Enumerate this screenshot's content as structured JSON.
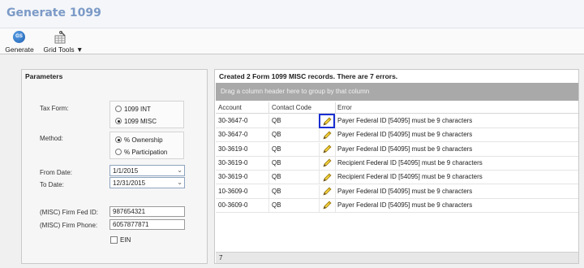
{
  "window": {
    "title": "Generate 1099"
  },
  "toolbar": {
    "generate_label": "Generate",
    "generate_icon_text": "GS",
    "grid_tools_label": "Grid Tools ▼"
  },
  "parameters": {
    "heading": "Parameters",
    "tax_form_label": "Tax Form:",
    "tax_form_options": [
      "1099 INT",
      "1099 MISC"
    ],
    "tax_form_selected": "1099 MISC",
    "method_label": "Method:",
    "method_options": [
      "% Ownership",
      "% Participation"
    ],
    "method_selected": "% Ownership",
    "from_date_label": "From Date:",
    "from_date_value": "1/1/2015",
    "to_date_label": "To Date:",
    "to_date_value": "12/31/2015",
    "firm_fed_id_label": "(MISC) Firm Fed ID:",
    "firm_fed_id_value": "987654321",
    "firm_phone_label": "(MISC) Firm Phone:",
    "firm_phone_value": "6057877871",
    "ein_label": "EIN",
    "ein_checked": false
  },
  "results": {
    "status_message": "Created 2 Form 1099 MISC records. There are 7 errors.",
    "group_hint": "Drag a column header here to group by that column",
    "columns": [
      "Account",
      "Contact Code",
      "Error"
    ],
    "rows": [
      {
        "account": "30-3647-0",
        "contact_code": "QB",
        "error": "Payer Federal ID [54095] must be 9 characters"
      },
      {
        "account": "30-3647-0",
        "contact_code": "QB",
        "error": "Payer Federal ID [54095] must be 9 characters"
      },
      {
        "account": "30-3619-0",
        "contact_code": "QB",
        "error": "Payer Federal ID [54095] must be 9 characters"
      },
      {
        "account": "30-3619-0",
        "contact_code": "QB",
        "error": "Recipient Federal ID [54095] must be 9 characters"
      },
      {
        "account": "30-3619-0",
        "contact_code": "QB",
        "error": "Recipient Federal ID [54095] must be 9 characters"
      },
      {
        "account": "10-3609-0",
        "contact_code": "QB",
        "error": "Payer Federal ID [54095] must be 9 characters"
      },
      {
        "account": "00-3609-0",
        "contact_code": "QB",
        "error": "Payer Federal ID [54095] must be 9 characters"
      }
    ],
    "footer_count": "7"
  },
  "icons": {
    "generate": "generate-icon",
    "grid_tools": "grid-tools-icon",
    "edit": "pencil-icon",
    "dropdown": "chevron-down-icon"
  },
  "colors": {
    "title": "#7b9ac7",
    "group_band": "#a9a9a9",
    "focus_outline": "#1a2fd1",
    "pencil": "#e7c21a"
  }
}
